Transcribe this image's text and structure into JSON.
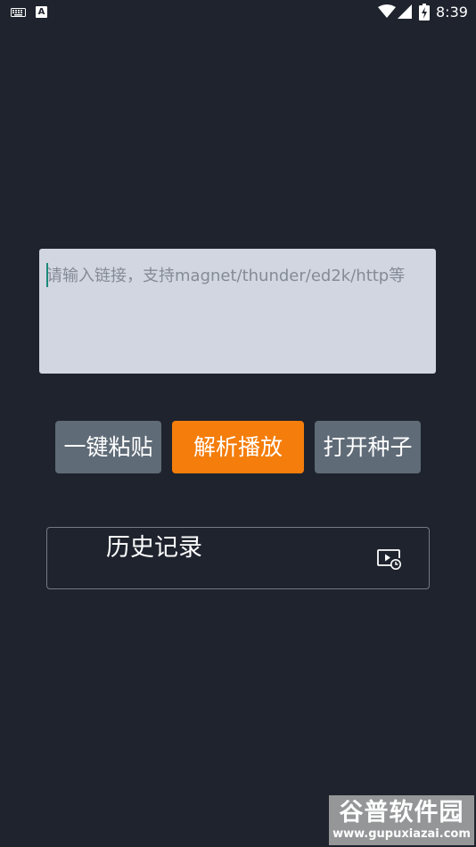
{
  "status_bar": {
    "keyboard_icon": "keyboard-icon",
    "notification_icon": "text-a-icon",
    "notification_letter": "A",
    "wifi_icon": "wifi-icon",
    "signal_icon": "cell-signal-icon",
    "battery_icon": "battery-charging-icon",
    "time": "8:39"
  },
  "link_input": {
    "placeholder": "请输入链接，支持magnet/thunder/ed2k/http等",
    "value": ""
  },
  "buttons": {
    "paste_label": "一键粘贴",
    "parse_label": "解析播放",
    "open_torrent_label": "打开种子"
  },
  "history": {
    "label": "历史记录",
    "icon": "video-history-icon"
  },
  "watermark": {
    "title": "谷普软件园",
    "url": "www.gupuxiazai.com"
  },
  "colors": {
    "background": "#1e232d",
    "input_background": "#d1d6e1",
    "accent_button": "#f47d0b",
    "secondary_button": "#5f6b77"
  }
}
